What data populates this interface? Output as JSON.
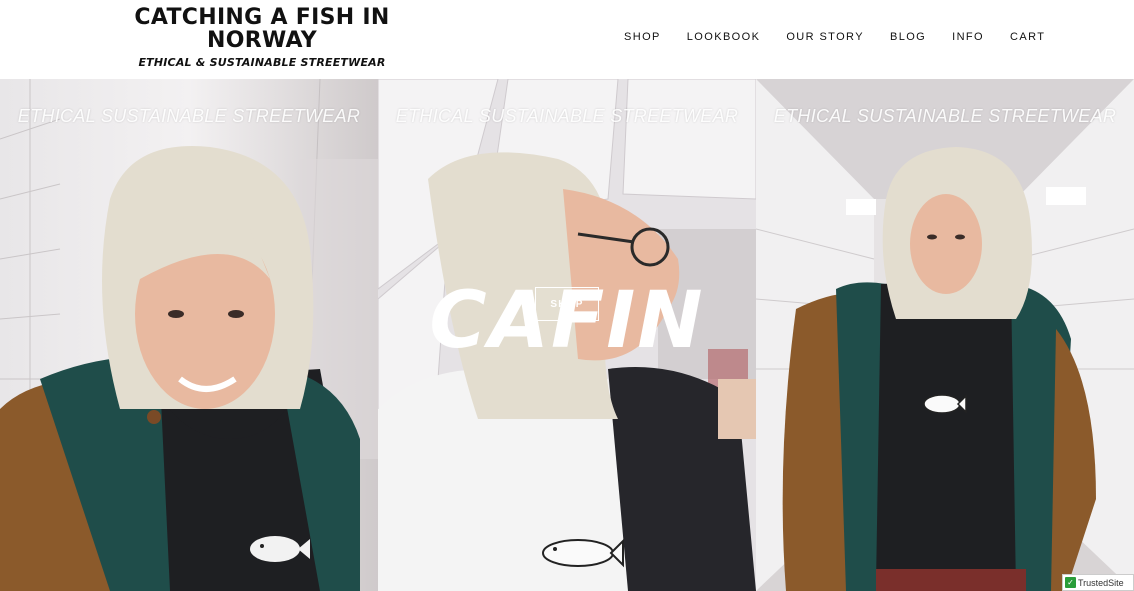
{
  "header": {
    "logo_line1": "CATCHING A FISH IN",
    "logo_line2": "NORWAY",
    "tagline": "ETHICAL & SUSTAINABLE STREETWEAR"
  },
  "nav": [
    "SHOP",
    "LOOKBOOK",
    "OUR STORY",
    "BLOG",
    "INFO",
    "CART"
  ],
  "hero": {
    "panel_caption": "ETHICAL SUSTAINABLE STREETWEAR",
    "brand": "CAFIN",
    "shop_button": "SHOP"
  },
  "badge": {
    "label": "TrustedSite"
  },
  "colors": {
    "tunnel": "#d9d4d3",
    "jacket_brown": "#8b5a2b",
    "jacket_teal": "#1f4d4a",
    "sweatshirt": "#1e1f22",
    "hair": "#e3ddcf"
  }
}
